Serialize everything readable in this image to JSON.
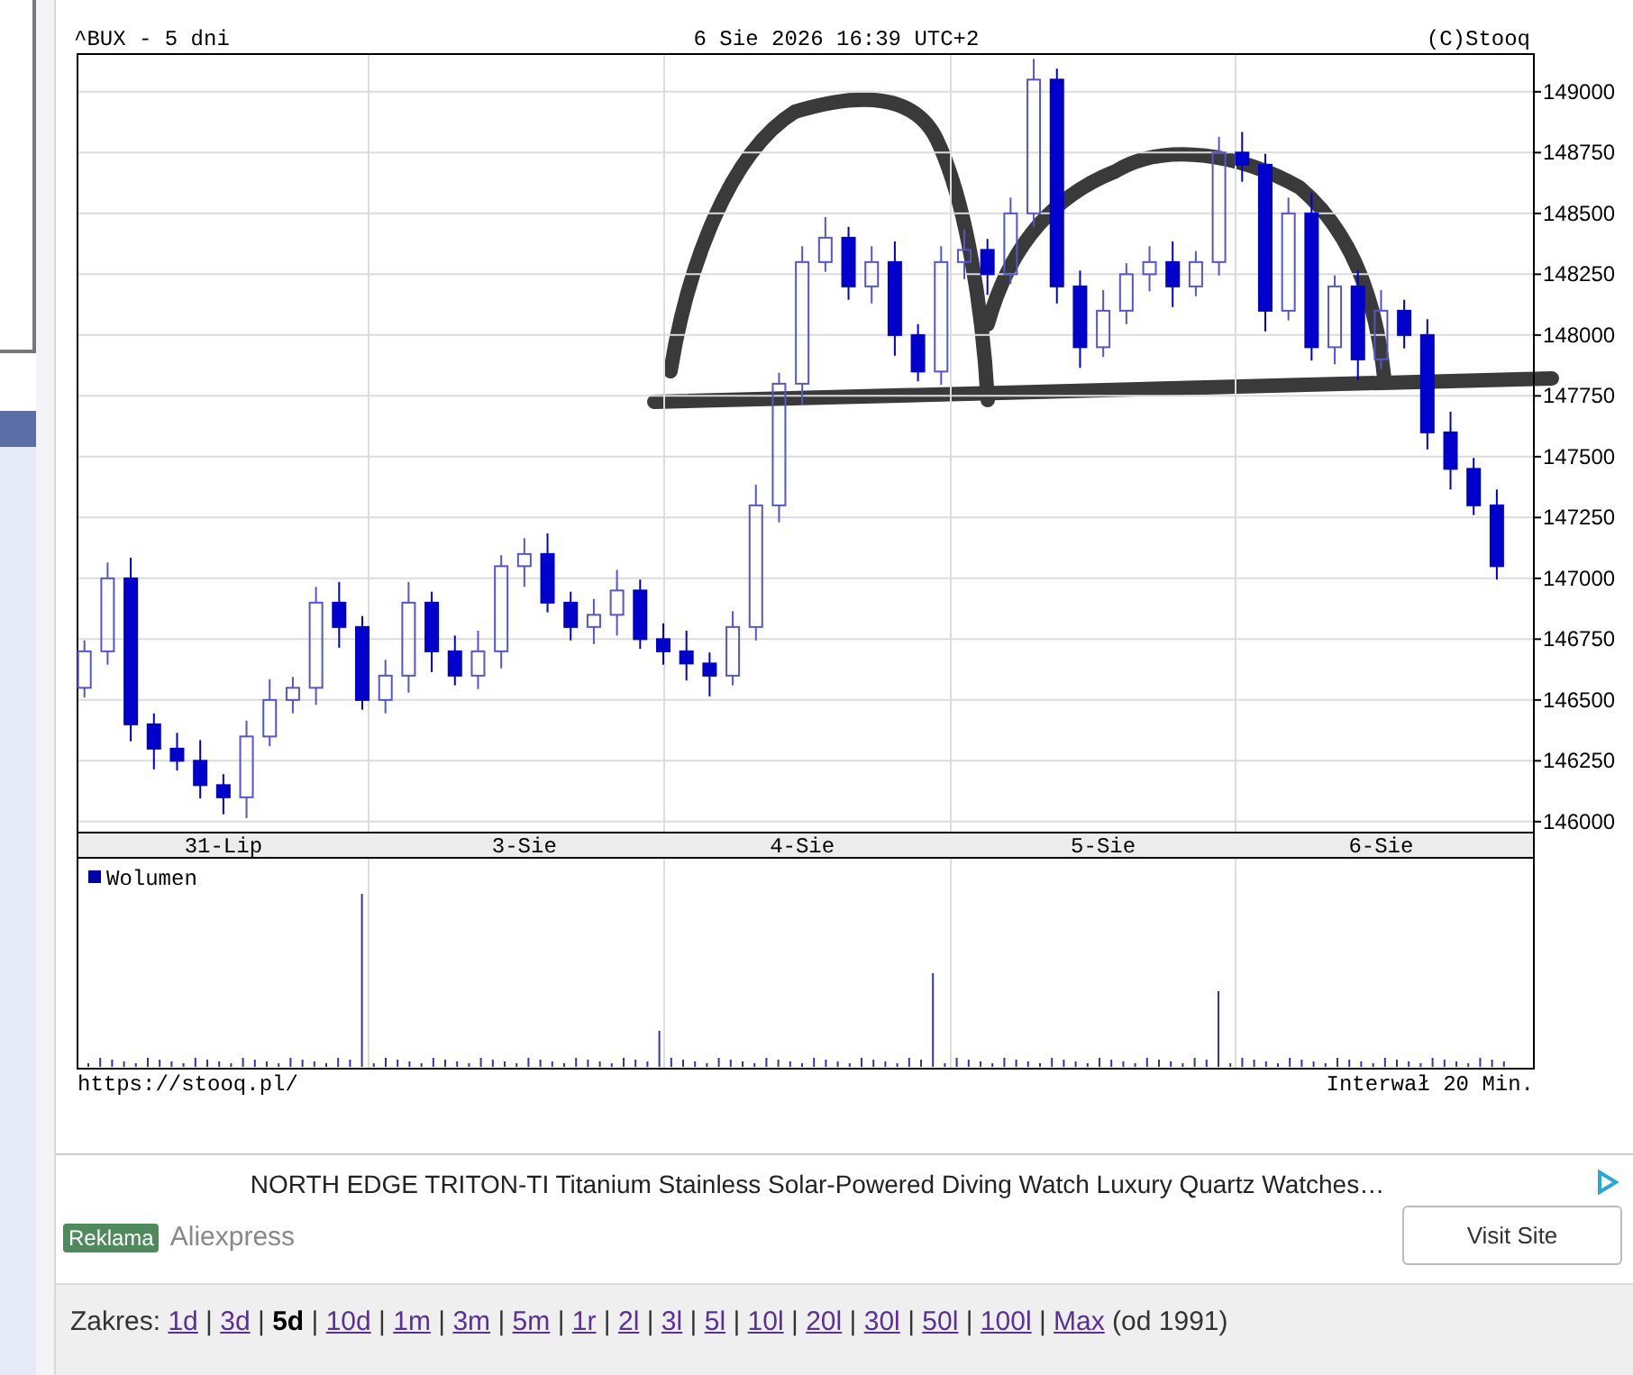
{
  "chart_header": {
    "title": "^BUX - 5 dni",
    "timestamp": "6 Sie 2026 16:39 UTC+2",
    "credit": "(C)Stooq"
  },
  "price_chart": {
    "chart_data": {
      "type": "candlestick",
      "grid": true,
      "ylim": [
        145955,
        149155
      ],
      "yticks": [
        146000,
        146250,
        146500,
        146750,
        147000,
        147250,
        147500,
        147750,
        148000,
        148250,
        148500,
        148750,
        149000
      ],
      "categories": [
        null,
        null,
        null,
        null,
        null,
        null,
        "31-Lip",
        null,
        null,
        null,
        null,
        null,
        null,
        null,
        null,
        null,
        null,
        null,
        null,
        "3-Sie",
        null,
        null,
        null,
        null,
        null,
        null,
        null,
        null,
        null,
        null,
        null,
        "4-Sie",
        null,
        null,
        null,
        null,
        null,
        null,
        null,
        null,
        null,
        null,
        null,
        null,
        "5-Sie",
        null,
        null,
        null,
        null,
        null,
        null,
        null,
        null,
        null,
        null,
        null,
        "6-Sie",
        null,
        null,
        null,
        null,
        null
      ],
      "ohlc": [
        [
          146550,
          146745,
          146510,
          146700
        ],
        [
          146700,
          147065,
          146645,
          147000
        ],
        [
          147000,
          147085,
          146330,
          146400
        ],
        [
          146400,
          146445,
          146215,
          146300
        ],
        [
          146300,
          146365,
          146210,
          146250
        ],
        [
          146250,
          146335,
          146095,
          146150
        ],
        [
          146150,
          146195,
          146030,
          146100
        ],
        [
          146100,
          146415,
          146015,
          146350
        ],
        [
          146350,
          146585,
          146310,
          146500
        ],
        [
          146500,
          146595,
          146445,
          146550
        ],
        [
          146550,
          146965,
          146480,
          146900
        ],
        [
          146900,
          146985,
          146715,
          146800
        ],
        [
          146800,
          146845,
          146460,
          146500
        ],
        [
          146500,
          146665,
          146445,
          146600
        ],
        [
          146600,
          146985,
          146530,
          146900
        ],
        [
          146900,
          146945,
          146615,
          146700
        ],
        [
          146700,
          146765,
          146560,
          146600
        ],
        [
          146600,
          146785,
          146545,
          146700
        ],
        [
          146700,
          147095,
          146630,
          147050
        ],
        [
          147050,
          147165,
          146965,
          147100
        ],
        [
          147100,
          147185,
          146860,
          146900
        ],
        [
          146900,
          146945,
          146745,
          146800
        ],
        [
          146800,
          146915,
          146730,
          146850
        ],
        [
          146850,
          147035,
          146765,
          146950
        ],
        [
          146950,
          146995,
          146710,
          146750
        ],
        [
          146750,
          146815,
          146645,
          146700
        ],
        [
          146700,
          146785,
          146580,
          146650
        ],
        [
          146650,
          146695,
          146515,
          146600
        ],
        [
          146600,
          146865,
          146560,
          146800
        ],
        [
          146800,
          147385,
          146745,
          147300
        ],
        [
          147300,
          147845,
          147230,
          147800
        ],
        [
          147800,
          148365,
          147715,
          148300
        ],
        [
          148300,
          148485,
          148260,
          148400
        ],
        [
          148400,
          148445,
          148145,
          148200
        ],
        [
          148200,
          148365,
          148130,
          148300
        ],
        [
          148300,
          148385,
          147915,
          148000
        ],
        [
          148000,
          148045,
          147810,
          147850
        ],
        [
          147850,
          148365,
          147795,
          148300
        ],
        [
          148300,
          148435,
          148230,
          148350
        ],
        [
          148350,
          148395,
          148165,
          148250
        ],
        [
          148250,
          148565,
          148210,
          148500
        ],
        [
          148500,
          149135,
          148445,
          149050
        ],
        [
          149050,
          149095,
          148130,
          148200
        ],
        [
          148200,
          148265,
          147865,
          147950
        ],
        [
          147950,
          148185,
          147910,
          148100
        ],
        [
          148100,
          148295,
          148045,
          148250
        ],
        [
          148250,
          148365,
          148180,
          148300
        ],
        [
          148300,
          148385,
          148115,
          148200
        ],
        [
          148200,
          148345,
          148160,
          148300
        ],
        [
          148300,
          148815,
          148245,
          148750
        ],
        [
          148750,
          148835,
          148630,
          148700
        ],
        [
          148700,
          148745,
          148015,
          148100
        ],
        [
          148100,
          148565,
          148060,
          148500
        ],
        [
          148500,
          148585,
          147895,
          147950
        ],
        [
          147950,
          148245,
          147880,
          148200
        ],
        [
          148200,
          148265,
          147815,
          147900
        ],
        [
          147900,
          148185,
          147860,
          148100
        ],
        [
          148100,
          148145,
          147945,
          148000
        ],
        [
          148000,
          148065,
          147530,
          147600
        ],
        [
          147600,
          147685,
          147365,
          147450
        ],
        [
          147450,
          147495,
          147260,
          147300
        ],
        [
          147300,
          147365,
          146995,
          147050
        ]
      ]
    }
  },
  "volume_panel": {
    "legend": "Wolumen"
  },
  "chart_footer": {
    "source": "https://stooq.pl/",
    "interval": "Interwał 20 Min."
  },
  "ad": {
    "headline": "NORTH EDGE TRITON-TI Titanium Stainless Solar-Powered Diving Watch Luxury Quartz Watches…",
    "label": "Reklama",
    "advertiser": "Aliexpress",
    "button": "Visit Site"
  },
  "range": {
    "label": "Zakres:",
    "separator": "|",
    "since": "(od 1991)",
    "options": [
      {
        "label": "1d",
        "selected": false
      },
      {
        "label": "3d",
        "selected": false
      },
      {
        "label": "5d",
        "selected": true
      },
      {
        "label": "10d",
        "selected": false
      },
      {
        "label": "1m",
        "selected": false
      },
      {
        "label": "3m",
        "selected": false
      },
      {
        "label": "5m",
        "selected": false
      },
      {
        "label": "1r",
        "selected": false
      },
      {
        "label": "2l",
        "selected": false
      },
      {
        "label": "3l",
        "selected": false
      },
      {
        "label": "5l",
        "selected": false
      },
      {
        "label": "10l",
        "selected": false
      },
      {
        "label": "20l",
        "selected": false
      },
      {
        "label": "30l",
        "selected": false
      },
      {
        "label": "50l",
        "selected": false
      },
      {
        "label": "100l",
        "selected": false
      },
      {
        "label": "Max",
        "selected": false
      }
    ]
  }
}
